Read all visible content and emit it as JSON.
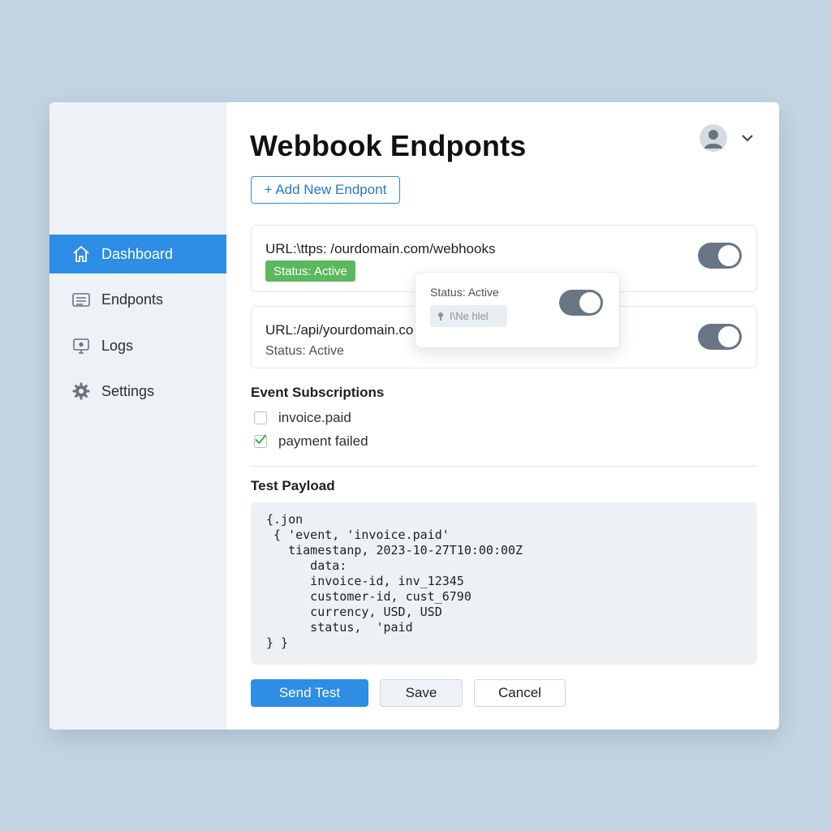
{
  "page": {
    "title": "Webbook Endponts",
    "add_button": "+ Add New Endpont"
  },
  "sidebar": {
    "items": [
      {
        "label": "Dashboard",
        "icon": "home-icon",
        "active": true
      },
      {
        "label": "Endponts",
        "icon": "list-icon",
        "active": false
      },
      {
        "label": "Logs",
        "icon": "monitor-icon",
        "active": false
      },
      {
        "label": "Settings",
        "icon": "gear-icon",
        "active": false
      }
    ]
  },
  "user": {
    "avatar_icon": "user-avatar-icon",
    "menu_icon": "chevron-down-icon"
  },
  "endpoints": [
    {
      "url_label": "URL:",
      "url": "\\ttps: /ourdomain.com/webhooks",
      "status": "Status: Active",
      "enabled": true
    },
    {
      "url_label": "URL:",
      "url": "/api/yourdomain.co",
      "status": "Status: Active",
      "enabled": true
    }
  ],
  "popover": {
    "status": "Status: Active",
    "chip": "I\\Ne hlel",
    "enabled": true
  },
  "subscriptions": {
    "title": "Event Subscriptions",
    "items": [
      {
        "label": "invoice.paid",
        "checked": false
      },
      {
        "label": "payment failed",
        "checked": true
      }
    ]
  },
  "payload": {
    "title": "Test Payload",
    "lines": [
      "{.jon",
      " { 'event, 'invoice.paid'",
      "   tiamestanp, 2023-10-27T10:00:00Z",
      "      data:",
      "      invoice-id, inv_12345",
      "      customer-id, cust_6790",
      "      currency, USD, USD",
      "      status,  'paid",
      "} }"
    ]
  },
  "actions": {
    "send": "Send Test",
    "save": "Save",
    "cancel": "Cancel"
  },
  "colors": {
    "accent": "#2e8de4",
    "status_green": "#5cb85c",
    "toggle_on": "#687684",
    "background": "#c3d5e4"
  }
}
